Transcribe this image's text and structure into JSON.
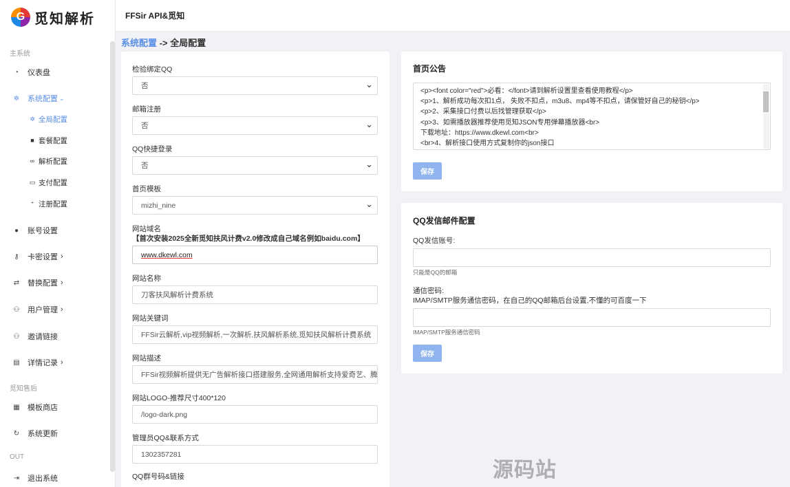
{
  "brand": {
    "logo_letter": "G",
    "name": "觅知解析"
  },
  "header": {
    "title": "FFSir API&觅知"
  },
  "breadcrumb": {
    "parent": "系统配置",
    "separator": "->",
    "current": "全局配置"
  },
  "sidebar": {
    "sections": {
      "main": "主系统",
      "after_sales": "觅知售后",
      "out": "OUT"
    },
    "items": {
      "dashboard": "仪表盘",
      "system_config": "系统配置",
      "global_config": "全局配置",
      "package_config": "套餐配置",
      "parse_config": "解析配置",
      "payment_config": "支付配置",
      "register_config": "注册配置",
      "account_settings": "账号设置",
      "card_settings": "卡密设置",
      "replace_config": "替换配置",
      "user_management": "用户管理",
      "invite_link": "邀请链接",
      "detail_records": "详情记录",
      "template_store": "模板商店",
      "system_update": "系统更新",
      "logout": "退出系统"
    }
  },
  "form": {
    "bind_qq": {
      "label": "检验绑定QQ",
      "value": "否"
    },
    "email_register": {
      "label": "邮箱注册",
      "value": "否"
    },
    "qq_quick_login": {
      "label": "QQ快捷登录",
      "value": "否"
    },
    "home_template": {
      "label": "首页模板",
      "value": "mizhi_nine"
    },
    "site_domain": {
      "label": "网站域名",
      "note": "【首次安装2025全新觅知扶风计费v2.0修改成自己域名例如baidu.com】",
      "value": "www.dkewl.com"
    },
    "site_name": {
      "label": "网站名称",
      "value": "刀客扶风解析计费系统"
    },
    "site_keywords": {
      "label": "网站关键词",
      "value": "FFSir云解析,vip视频解析,一次解析,扶风解析系统,觅知扶风解析计费系统"
    },
    "site_description": {
      "label": "网站描述",
      "value": "FFSir视频解析提供无广告解析接口搭建服务,全网通用解析支持爱奇艺、腾讯"
    },
    "site_logo": {
      "label": "网站LOGO-推荐尺寸400*120",
      "value": "/logo-dark.png"
    },
    "admin_qq": {
      "label": "管理员QQ&联系方式",
      "value": "1302357281"
    },
    "qq_group": {
      "label": "QQ群号码&链接"
    }
  },
  "announcement": {
    "title": "首页公告",
    "lines": [
      "<p><font color=\"red\">必看：</font>请到解析设置里查看使用教程</p>",
      "<p>1、解析成功每次扣1点， 失败不扣点，m3u8、mp4等不扣点，请保管好自己的秘钥</p>",
      "<p>2、采集接口付费以后找管理获取</p>",
      "<p>3、如需播放器推荐使用觅知JSON专用弹幕播放器<br>",
      "下载地址：https://www.dkewl.com<br>",
      "<br>4、解析接口使用方式复制你的json接口"
    ],
    "save_label": "保存"
  },
  "mail": {
    "title": "QQ发信邮件配置",
    "account_label": "QQ发信账号:",
    "account_help": "只能是QQ的邮箱",
    "password_label": "通信密码:",
    "password_desc": "IMAP/SMTP服务通信密码，在自己的QQ邮箱后台设置,不懂的可百度一下",
    "password_help": "IMAP/SMTP服务通信密码",
    "save_label": "保存"
  },
  "watermark": "源码站www.yuanmaz.com"
}
